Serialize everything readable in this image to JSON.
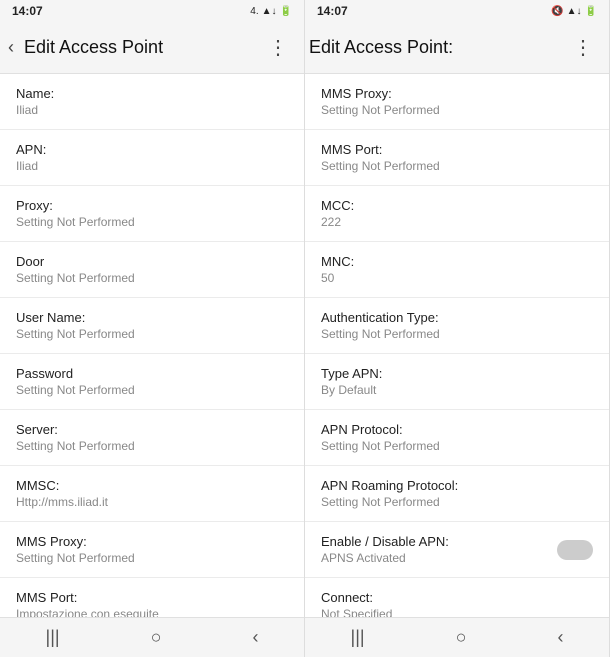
{
  "panel_left": {
    "status": {
      "time": "14:07",
      "icons": "4. ▲↓🔋"
    },
    "header": {
      "back_label": "‹",
      "title": "Edit Access Point",
      "menu_icon": "⋮"
    },
    "items": [
      {
        "label": "Name:",
        "value": "Iliad"
      },
      {
        "label": "APN:",
        "value": "Iliad"
      },
      {
        "label": "Proxy:",
        "value": "Setting Not Performed"
      },
      {
        "label": "Door",
        "value": "Setting Not Performed"
      },
      {
        "label": "User Name:",
        "value": "Setting Not Performed"
      },
      {
        "label": "Password",
        "value": "Setting Not Performed"
      },
      {
        "label": "Server:",
        "value": "Setting Not Performed"
      },
      {
        "label": "MMSC:",
        "value": "Http://mms.iliad.it"
      },
      {
        "label": "MMS Proxy:",
        "value": "Setting Not Performed"
      },
      {
        "label": "MMS Port:",
        "value": "Impostazione con eseguite"
      }
    ],
    "nav": [
      "|||",
      "○",
      "‹"
    ]
  },
  "panel_right": {
    "status": {
      "time": "14:07",
      "icons": "🔇 ▲↓🔋"
    },
    "header": {
      "back_label": "",
      "title": "Edit Access Point:",
      "menu_icon": "⋮"
    },
    "items": [
      {
        "label": "MMS Proxy:",
        "value": "Setting Not Performed"
      },
      {
        "label": "MMS Port:",
        "value": "Setting Not Performed"
      },
      {
        "label": "MCC:",
        "value": "222"
      },
      {
        "label": "MNC:",
        "value": "50"
      },
      {
        "label": "Authentication Type:",
        "value": "Setting Not Performed"
      },
      {
        "label": "Type APN:",
        "value": "By Default"
      },
      {
        "label": "APN Protocol:",
        "value": "Setting Not Performed"
      },
      {
        "label": "APN Roaming Protocol:",
        "value": "Setting Not Performed"
      },
      {
        "label": "Enable / Disable APN:",
        "value": "APNS Activated",
        "toggle": true
      },
      {
        "label": "Connect:",
        "value": "Not Specified"
      }
    ],
    "nav": [
      "|||",
      "○",
      "‹"
    ]
  }
}
